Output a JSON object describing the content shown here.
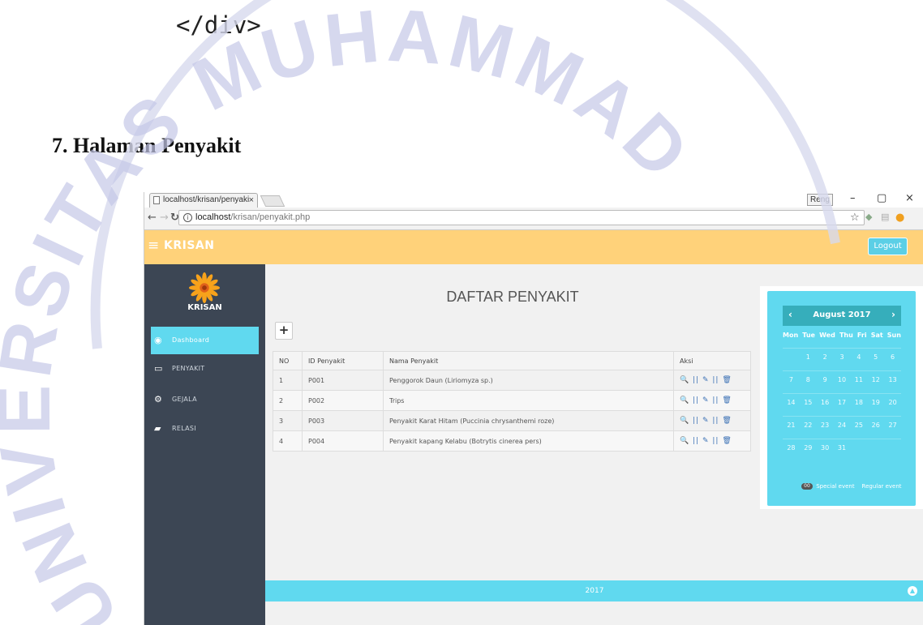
{
  "document": {
    "code_line": "</div>",
    "heading": "7. Halaman Penyakit"
  },
  "watermark": {
    "text": "UNIVERSITAS MUHAMMADIYAH",
    "color": "#c5c8e8"
  },
  "browser": {
    "tab_title": "localhost/krisan/penyaki",
    "tab_close": "×",
    "user_badge": "Reng",
    "window_controls": [
      "–",
      "▢",
      "×"
    ],
    "url_host": "localhost",
    "url_path": "/krisan/penyakit.php",
    "bookmark_icon": "☆"
  },
  "app": {
    "brand": "KRISAN",
    "logout_label": "Logout",
    "sidebar": {
      "title": "KRISAN",
      "items": [
        {
          "label": "Dashboard",
          "icon": "dashboard-icon",
          "glyph": "◉"
        },
        {
          "label": "PENYAKIT",
          "icon": "monitor-icon",
          "glyph": "▭"
        },
        {
          "label": "GEJALA",
          "icon": "gears-icon",
          "glyph": "⚙"
        },
        {
          "label": "RELASI",
          "icon": "book-icon",
          "glyph": "▰"
        }
      ]
    },
    "main": {
      "title": "DAFTAR PENYAKIT",
      "add_label": "+",
      "table": {
        "headers": [
          "NO",
          "ID Penyakit",
          "Nama Penyakit",
          "Aksi"
        ],
        "rows": [
          [
            "1",
            "P001",
            "Penggorok Daun (Liriomyza sp.)"
          ],
          [
            "2",
            "P002",
            "Trips"
          ],
          [
            "3",
            "P003",
            "Penyakit Karat Hitam (Puccinia chrysanthemi roze)"
          ],
          [
            "4",
            "P004",
            "Penyakit kapang Kelabu (Botrytis cinerea pers)"
          ]
        ],
        "actions_text": "🔍 || ✎ || 🗑"
      }
    },
    "calendar": {
      "month": "August 2017",
      "prev": "‹",
      "next": "›",
      "days": [
        "Mon",
        "Tue",
        "Wed",
        "Thu",
        "Fri",
        "Sat",
        "Sun"
      ],
      "weeks": [
        [
          "",
          "1",
          "2",
          "3",
          "4",
          "5",
          "6"
        ],
        [
          "7",
          "8",
          "9",
          "10",
          "11",
          "12",
          "13"
        ],
        [
          "14",
          "15",
          "16",
          "17",
          "18",
          "19",
          "20"
        ],
        [
          "21",
          "22",
          "23",
          "24",
          "25",
          "26",
          "27"
        ],
        [
          "28",
          "29",
          "30",
          "31",
          "",
          "",
          ""
        ]
      ],
      "legend_badge": "00",
      "legend_special": "Special event",
      "legend_regular": "Regular event"
    },
    "footer": "2017",
    "colors": {
      "header": "#ffd27a",
      "sidebar": "#3c4654",
      "accent": "#60d9ef",
      "calendar_head": "#36aebb"
    }
  }
}
